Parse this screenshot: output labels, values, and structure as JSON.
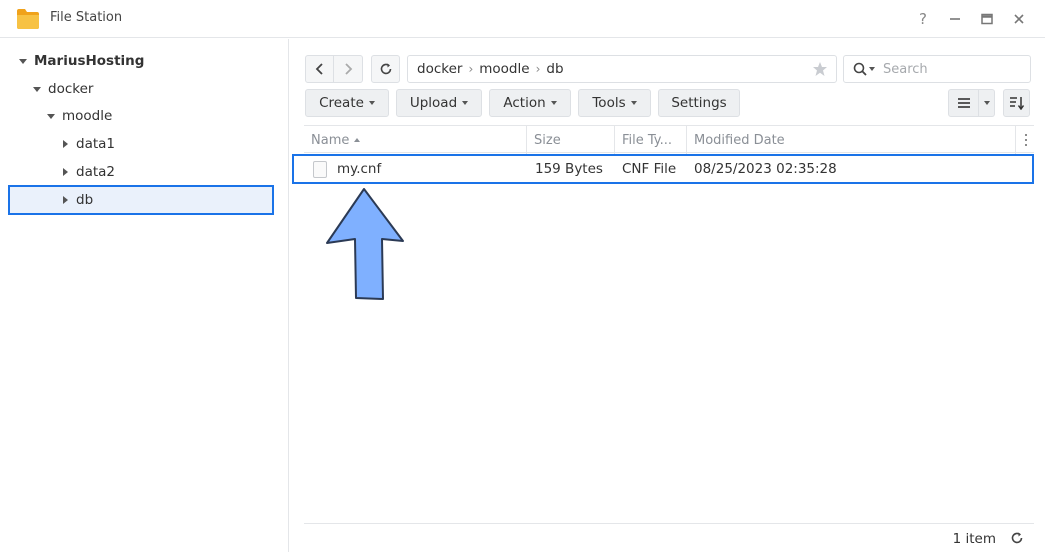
{
  "window": {
    "title": "File Station",
    "icon": "folder-icon",
    "buttons": [
      "help-icon",
      "minimize-icon",
      "maximize-icon",
      "close-icon"
    ],
    "help_label": "?"
  },
  "sidebar": {
    "items": [
      {
        "label": "MariusHosting",
        "level": 0,
        "expanded": true
      },
      {
        "label": "docker",
        "level": 1,
        "expanded": true
      },
      {
        "label": "moodle",
        "level": 2,
        "expanded": true
      },
      {
        "label": "data1",
        "level": 3,
        "expanded": false
      },
      {
        "label": "data2",
        "level": 3,
        "expanded": false
      },
      {
        "label": "db",
        "level": 3,
        "expanded": false,
        "selected": true
      }
    ]
  },
  "breadcrumb": {
    "parts": [
      "docker",
      "moodle",
      "db"
    ],
    "separator": "›"
  },
  "search": {
    "placeholder": "Search",
    "value": ""
  },
  "toolbar": {
    "create_label": "Create",
    "upload_label": "Upload",
    "action_label": "Action",
    "tools_label": "Tools",
    "settings_label": "Settings"
  },
  "table": {
    "columns": [
      "Name",
      "Size",
      "File Ty...",
      "Modified Date"
    ],
    "sort_column": "Name",
    "sort_direction": "ascending",
    "rows": [
      {
        "name": "my.cnf",
        "size": "159 Bytes",
        "type": "CNF File",
        "modified": "08/25/2023 02:35:28",
        "selected": true
      }
    ]
  },
  "footer": {
    "count_label": "1 item"
  },
  "colors": {
    "selection_border": "#1a73e8",
    "arrow_fill": "#7fb0ff",
    "arrow_stroke": "#2b3a55",
    "folder": "#f5b324"
  }
}
